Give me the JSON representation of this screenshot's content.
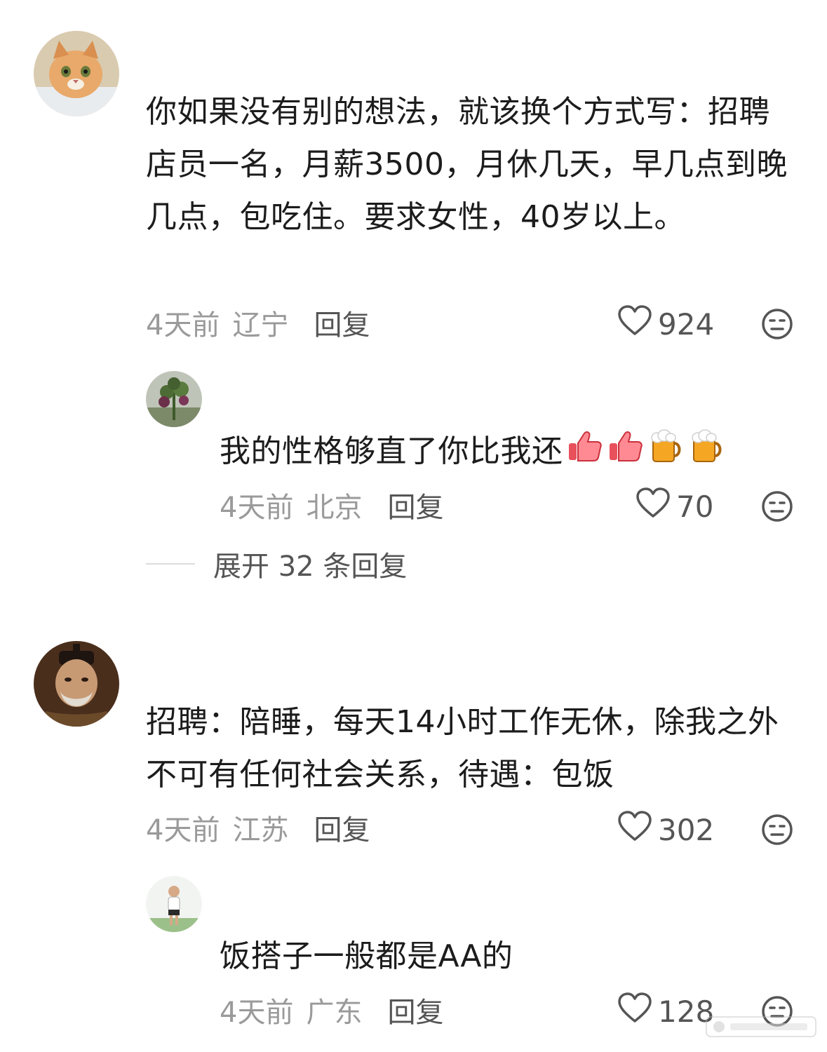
{
  "comments": [
    {
      "text": "你如果没有别的想法，就该换个方式写：招聘店员一名，月薪3500，月休几天，早几点到晚几点，包吃住。要求女性，40岁以上。",
      "time": "4天前",
      "location": "辽宁",
      "reply_label": "回复",
      "likes": "924",
      "avatar_icon": "cat-avatar",
      "reply": {
        "text": "我的性格够直了你比我还",
        "emojis": [
          "thumbs-up",
          "thumbs-up",
          "beer-mug",
          "beer-mug"
        ],
        "time": "4天前",
        "location": "北京",
        "reply_label": "回复",
        "likes": "70",
        "avatar_icon": "plant-avatar"
      },
      "expand_label": "展开 32 条回复"
    },
    {
      "text": "招聘：陪睡，每天14小时工作无休，除我之外不可有任何社会关系，待遇：包饭",
      "time": "4天前",
      "location": "江苏",
      "reply_label": "回复",
      "likes": "302",
      "avatar_icon": "historical-figure-avatar",
      "reply": {
        "text": "饭搭子一般都是AA的",
        "time": "4天前",
        "location": "广东",
        "reply_label": "回复",
        "likes": "128",
        "avatar_icon": "person-avatar"
      }
    }
  ],
  "colors": {
    "meta_gray": "#9a9a9a",
    "text_dark": "#1c1c1c",
    "icon_gray": "#555555",
    "emoji_red": "#e8505b",
    "beer_amber": "#f5a623"
  }
}
